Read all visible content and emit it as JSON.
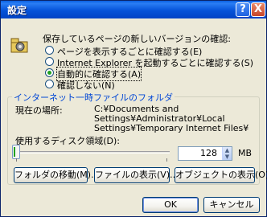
{
  "window": {
    "title": "設定",
    "help_label": "?",
    "close_label": "X"
  },
  "check_newer": {
    "heading": "保存しているページの新しいバージョンの確認:",
    "options": [
      {
        "label": "ページを表示するごとに確認する(E)",
        "checked": false
      },
      {
        "label": "Internet Explorer を起動するごとに確認する(S)",
        "checked": false
      },
      {
        "label": "自動的に確認する(A)",
        "checked": true
      },
      {
        "label": "確認しない(N)",
        "checked": false
      }
    ]
  },
  "temp_files": {
    "group_title": "インターネット一時ファイルのフォルダ",
    "current_location_label": "現在の場所:",
    "current_location_lines": [
      "C:¥Documents and",
      "Settings¥Administrator¥Local",
      "Settings¥Temporary Internet Files¥"
    ],
    "disk_space_label": "使用するディスク領域(D):",
    "disk_space_value": "128",
    "disk_space_unit": "MB",
    "move_folder_button": "フォルダの移動(M)...",
    "view_files_button": "ファイルの表示(V)...",
    "view_objects_button": "オブジェクトの表示(O)..."
  },
  "footer": {
    "ok_label": "OK",
    "cancel_label": "キャンセル"
  },
  "icons": {
    "settings": "gear-icon",
    "help": "help-icon",
    "close": "close-icon",
    "spinner": "spin-arrows-icon"
  },
  "colors": {
    "titlebar": "#0553d9",
    "dialog_bg": "#ece9d8",
    "group_title": "#0046d5"
  }
}
